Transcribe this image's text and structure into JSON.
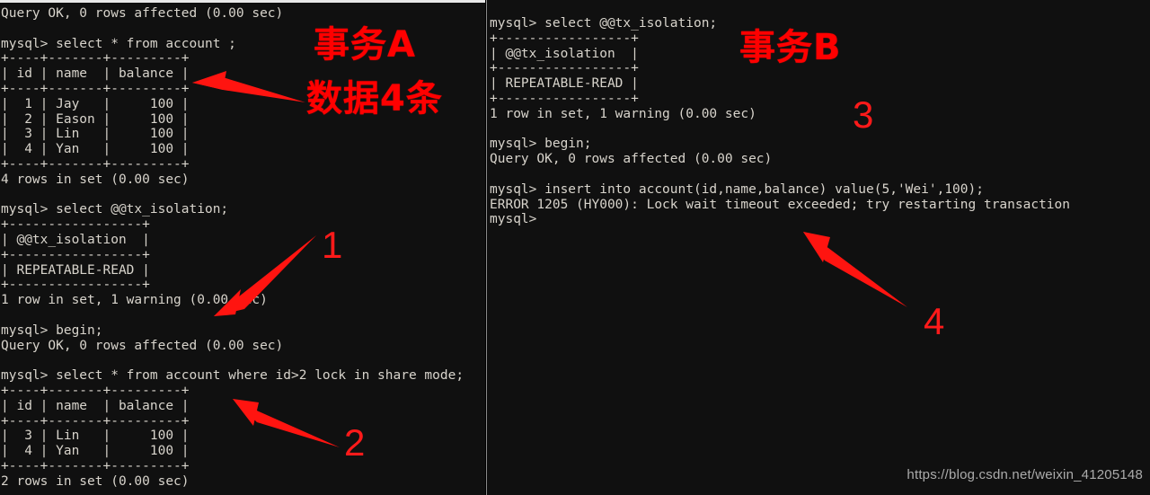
{
  "meta": {
    "watermark": "https://blog.csdn.net/weixin_41205148"
  },
  "left_terminal": {
    "name": "transaction-a-terminal",
    "lines": [
      "Query OK, 0 rows affected (0.00 sec)",
      "",
      "mysql> select * from account ;",
      "+----+-------+---------+",
      "| id | name  | balance |",
      "+----+-------+---------+",
      "|  1 | Jay   |     100 |",
      "|  2 | Eason |     100 |",
      "|  3 | Lin   |     100 |",
      "|  4 | Yan   |     100 |",
      "+----+-------+---------+",
      "4 rows in set (0.00 sec)",
      "",
      "mysql> select @@tx_isolation;",
      "+-----------------+",
      "| @@tx_isolation  |",
      "+-----------------+",
      "| REPEATABLE-READ |",
      "+-----------------+",
      "1 row in set, 1 warning (0.00 sec)",
      "",
      "mysql> begin;",
      "Query OK, 0 rows affected (0.00 sec)",
      "",
      "mysql> select * from account where id>2 lock in share mode;",
      "+----+-------+---------+",
      "| id | name  | balance |",
      "+----+-------+---------+",
      "|  3 | Lin   |     100 |",
      "|  4 | Yan   |     100 |",
      "+----+-------+---------+",
      "2 rows in set (0.00 sec)"
    ]
  },
  "right_terminal": {
    "name": "transaction-b-terminal",
    "lines": [
      "mysql> select @@tx_isolation;",
      "+-----------------+",
      "| @@tx_isolation  |",
      "+-----------------+",
      "| REPEATABLE-READ |",
      "+-----------------+",
      "1 row in set, 1 warning (0.00 sec)",
      "",
      "mysql> begin;",
      "Query OK, 0 rows affected (0.00 sec)",
      "",
      "mysql> insert into account(id,name,balance) value(5,'Wei',100);",
      "ERROR 1205 (HY000): Lock wait timeout exceeded; try restarting transaction",
      "mysql>"
    ]
  },
  "annotations": {
    "transaction_a_label": "事务A",
    "transaction_a_note": "数据4条",
    "transaction_b_label": "事务B",
    "step_1": "1",
    "step_2": "2",
    "step_3": "3",
    "step_4": "4",
    "arrow_color": "#ff1410"
  }
}
